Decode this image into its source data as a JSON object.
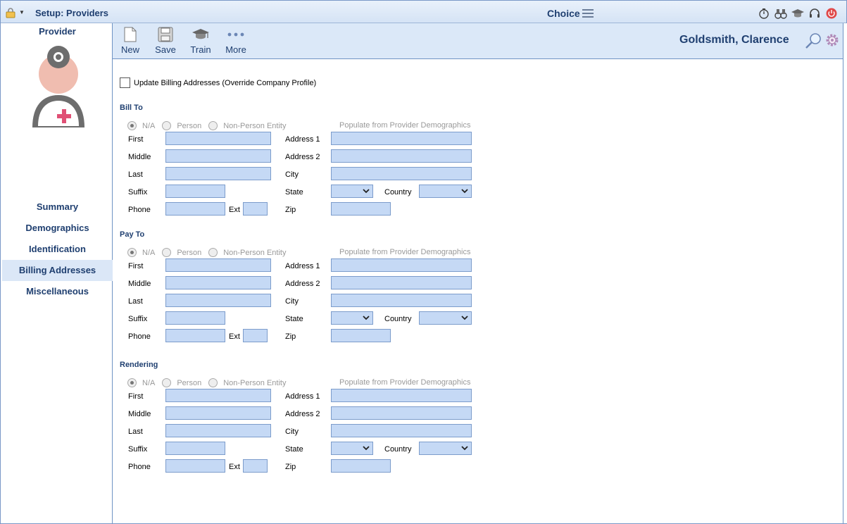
{
  "titlebar": {
    "title": "Setup: Providers",
    "center_title": "Choice",
    "icons": [
      "lock-icon",
      "stopwatch-icon",
      "binoculars-icon",
      "graduation-cap-icon",
      "headset-icon",
      "power-icon"
    ]
  },
  "sidebar": {
    "title": "Provider",
    "items": [
      {
        "label": "Summary",
        "active": false
      },
      {
        "label": "Demographics",
        "active": false
      },
      {
        "label": "Identification",
        "active": false
      },
      {
        "label": "Billing Addresses",
        "active": true
      },
      {
        "label": "Miscellaneous",
        "active": false
      }
    ]
  },
  "toolbar": {
    "new_label": "New",
    "save_label": "Save",
    "train_label": "Train",
    "more_label": "More",
    "patient_name": "Goldsmith, Clarence"
  },
  "form": {
    "override_label": "Update Billing Addresses (Override Company Profile)",
    "override_checked": false,
    "radio_na": "N/A",
    "radio_person": "Person",
    "radio_nonperson": "Non-Person Entity",
    "populate_label": "Populate from Provider Demographics",
    "labels": {
      "first": "First",
      "middle": "Middle",
      "last": "Last",
      "suffix": "Suffix",
      "phone": "Phone",
      "ext": "Ext",
      "address1": "Address 1",
      "address2": "Address 2",
      "city": "City",
      "state": "State",
      "country": "Country",
      "zip": "Zip"
    },
    "sections": [
      {
        "title": "Bill To"
      },
      {
        "title": "Pay To"
      },
      {
        "title": "Rendering"
      }
    ]
  },
  "colors": {
    "accent": "#1f3f70",
    "field_bg": "#c5d9f5",
    "toolbar_bg": "#dbe8f8"
  }
}
